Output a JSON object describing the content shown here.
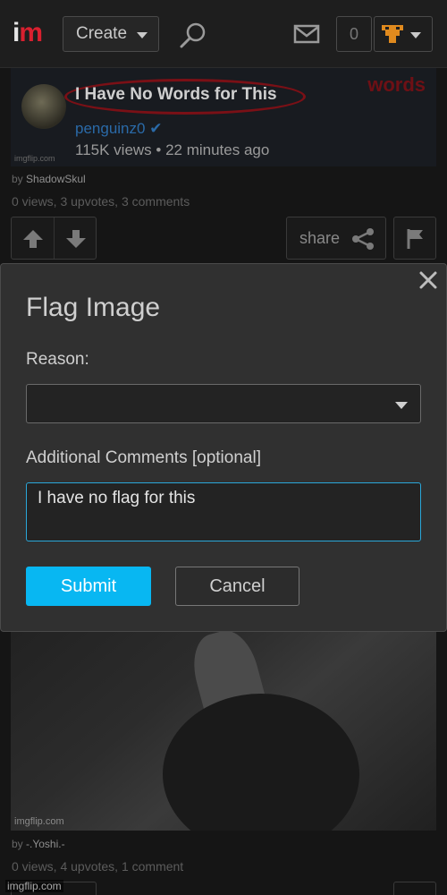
{
  "nav": {
    "logo_i": "i",
    "logo_m": "m",
    "create_label": "Create",
    "notification_count": "0",
    "colors": {
      "brand": "#d9202f",
      "avatar": "#e08a1e"
    }
  },
  "feed": {
    "post1": {
      "embedded_title": "I Have No Words for This",
      "embedded_channel": "penguinz0",
      "embedded_meta": "115K views • 22 minutes ago",
      "embedded_corner": "words",
      "watermark": "imgflip.com",
      "by_prefix": "by ",
      "author": "ShadowSkul",
      "stats": "0 views, 3 upvotes, 3 comments",
      "share_label": "share"
    },
    "post2": {
      "watermark": "imgflip.com",
      "by_prefix": "by ",
      "author": "-.Yoshi.-",
      "stats": "0 views, 4 upvotes, 1 comment"
    },
    "footer_watermark": "imgflip.com"
  },
  "modal": {
    "title": "Flag Image",
    "reason_label": "Reason:",
    "reason_value": "",
    "comments_label": "Additional Comments [optional]",
    "comments_value": "I have no flag for this",
    "submit_label": "Submit",
    "cancel_label": "Cancel",
    "colors": {
      "submit": "#08b7f2",
      "focus_border": "#2aa7d9"
    }
  }
}
